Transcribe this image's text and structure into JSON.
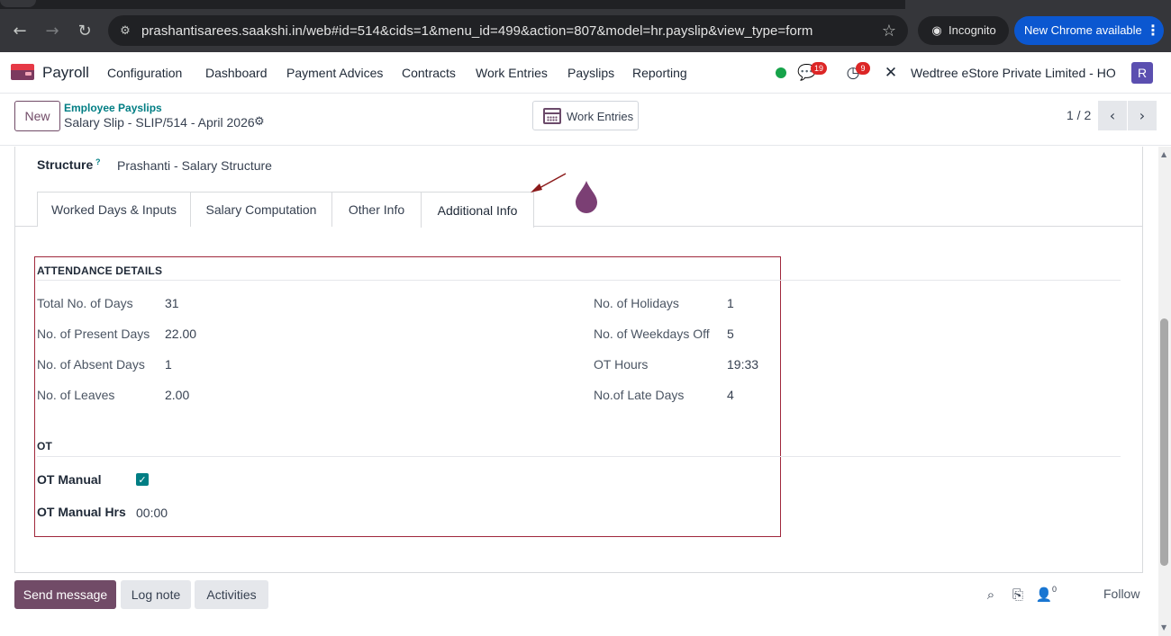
{
  "browser": {
    "url": "prashantisarees.saakshi.in/web#id=514&cids=1&menu_id=499&action=807&model=hr.payslip&view_type=form",
    "incognito_label": "Incognito",
    "update_label": "New Chrome available",
    "icons": [
      "back-icon",
      "forward-icon",
      "reload-icon",
      "site-info-icon",
      "star-icon",
      "incognito-icon",
      "menu-dots-icon"
    ]
  },
  "navbar": {
    "app_name": "Payroll",
    "menu": [
      "Configuration",
      "Dashboard",
      "Payment Advices",
      "Contracts",
      "Work Entries",
      "Payslips",
      "Reporting"
    ],
    "messages_badge": "19",
    "activities_badge": "9",
    "company": "Wedtree eStore Private Limited - HO",
    "user_initial": "R"
  },
  "control_panel": {
    "new_label": "New",
    "breadcrumb_parent": "Employee Payslips",
    "breadcrumb_current": "Salary Slip - SLIP/514 - April 2026",
    "work_entries_label": "Work Entries",
    "pager": "1 / 2"
  },
  "form": {
    "structure_label": "Structure",
    "structure_tooltip": "?",
    "structure_value": "Prashanti - Salary Structure",
    "tabs": [
      "Worked Days & Inputs",
      "Salary Computation",
      "Other Info",
      "Additional Info"
    ],
    "active_tab": "Additional Info",
    "attendance": {
      "title": "ATTENDANCE DETAILS",
      "left": [
        {
          "label": "Total No. of Days",
          "value": "31"
        },
        {
          "label": "No. of Present Days",
          "value": "22.00"
        },
        {
          "label": "No. of Absent Days",
          "value": "1"
        },
        {
          "label": "No. of Leaves",
          "value": "2.00"
        }
      ],
      "right": [
        {
          "label": "No. of Holidays",
          "value": "1"
        },
        {
          "label": "No. of Weekdays Off",
          "value": "5"
        },
        {
          "label": "OT Hours",
          "value": "19:33"
        },
        {
          "label": "No.of Late Days",
          "value": "4"
        }
      ]
    },
    "ot": {
      "title": "OT",
      "manual_label": "OT Manual",
      "manual_checked": true,
      "manual_hrs_label": "OT Manual Hrs",
      "manual_hrs_value": "00:00"
    }
  },
  "chatter": {
    "send_message": "Send message",
    "log_note": "Log note",
    "activities": "Activities",
    "follower_count": "0",
    "follow": "Follow"
  },
  "colors": {
    "brand": "#714b67",
    "teal": "#017e84",
    "highlight_border": "#a0283c",
    "chrome_update": "#0b57d0"
  }
}
